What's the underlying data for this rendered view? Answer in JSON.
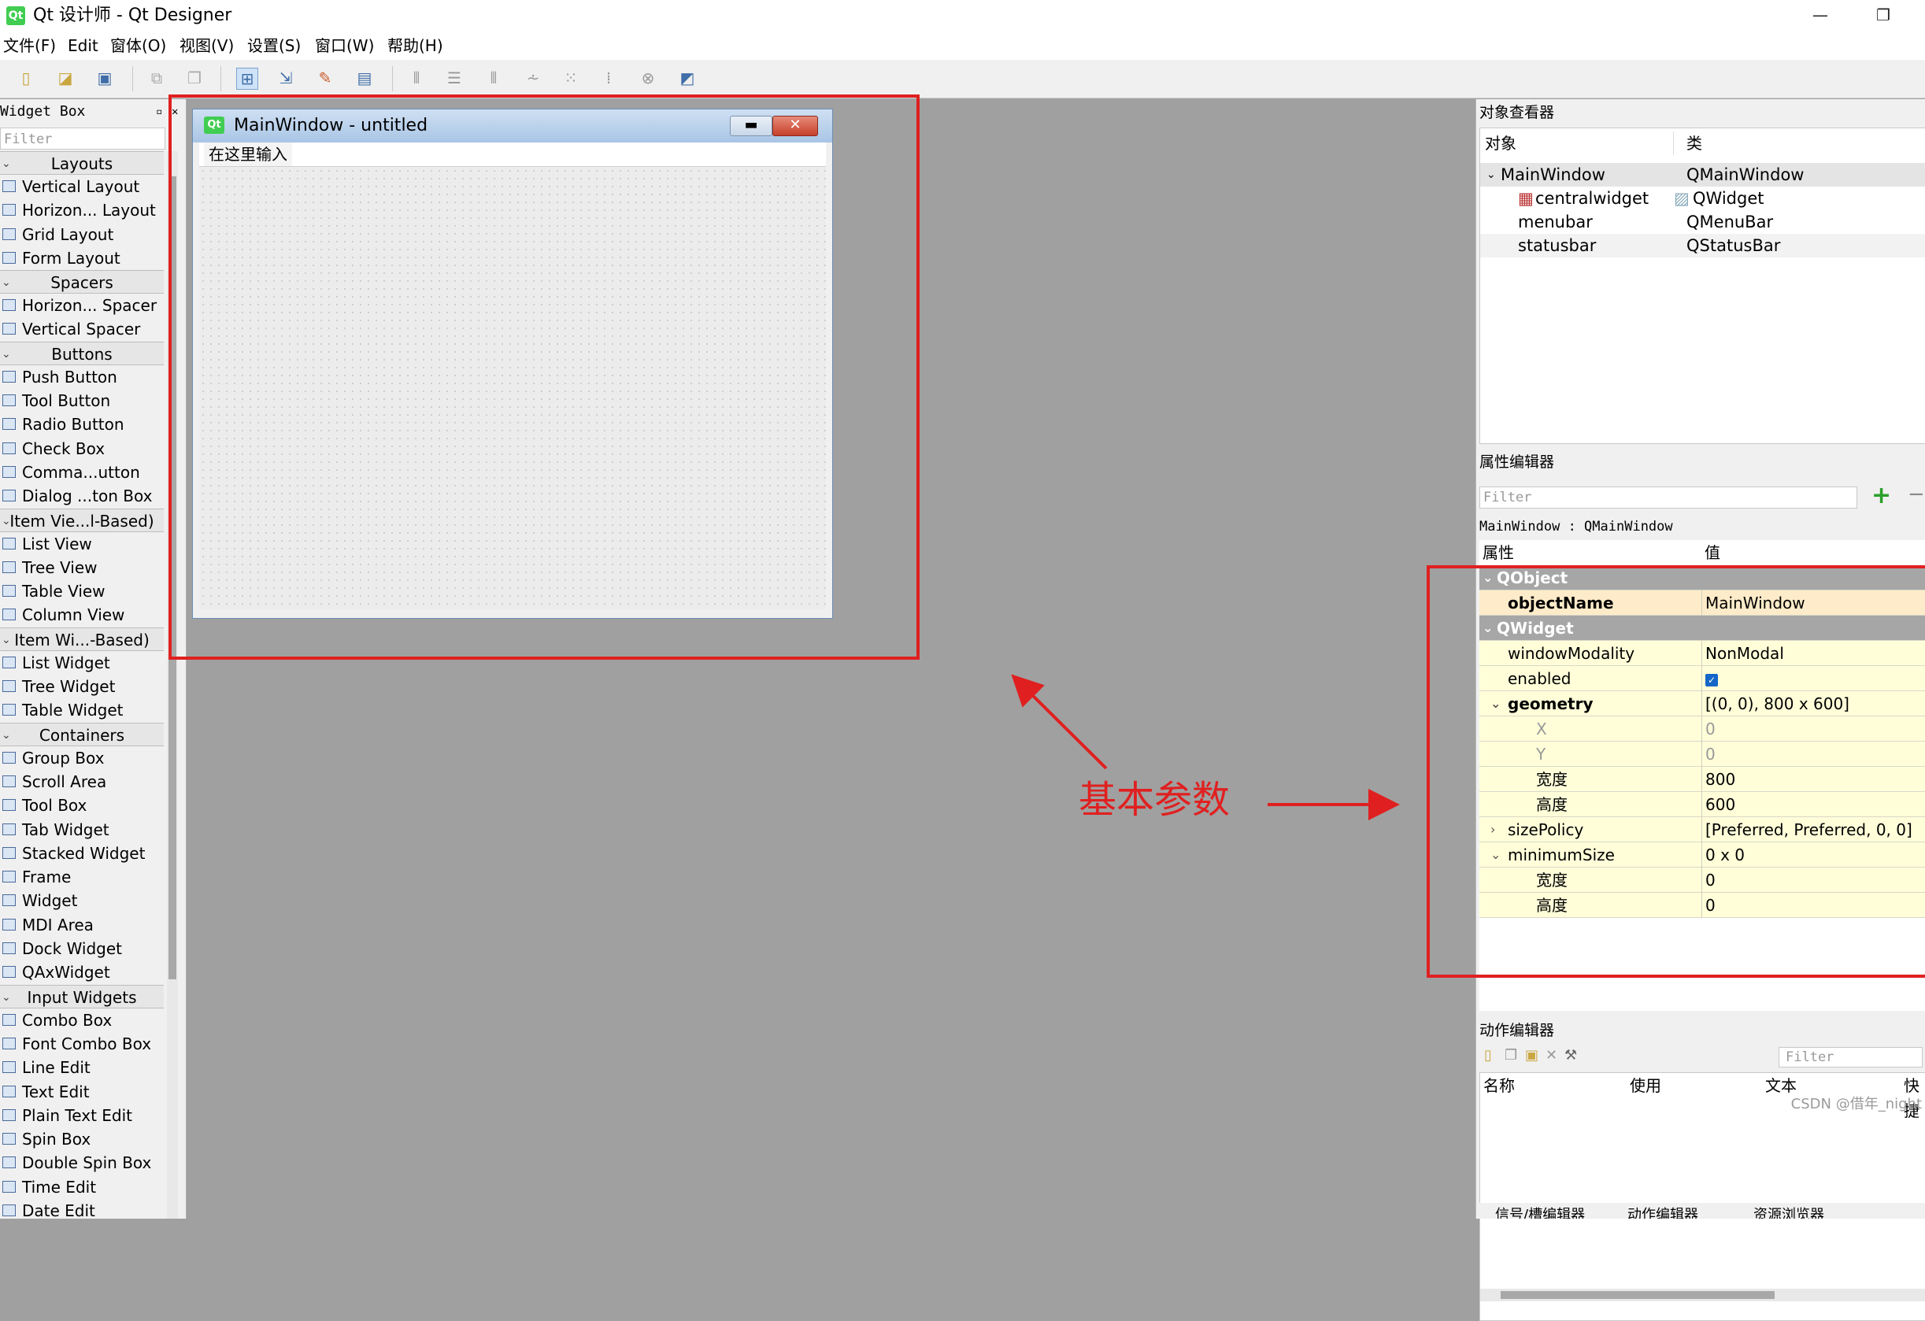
{
  "window": {
    "title": "Qt 设计师 - Qt Designer",
    "logo": "Qt",
    "minimize": "—",
    "restore": "❐"
  },
  "menubar": [
    "文件(F)",
    "Edit",
    "窗体(O)",
    "视图(V)",
    "设置(S)",
    "窗口(W)",
    "帮助(H)"
  ],
  "toolbar_icons": [
    "new-file-icon",
    "open-folder-icon",
    "save-icon",
    "cut-icon",
    "copy-icon",
    "edit-widgets-icon",
    "edit-signals-icon",
    "edit-buddies-icon",
    "edit-tab-order-icon",
    "layout-horizontal-icon",
    "layout-vertical-icon",
    "layout-h-splitter-icon",
    "layout-v-splitter-icon",
    "layout-grid-icon",
    "layout-form-icon",
    "break-layout-icon",
    "adjust-size-icon"
  ],
  "widget_box": {
    "title": "Widget Box",
    "filter_placeholder": "Filter",
    "groups": [
      {
        "name": "Layouts",
        "items": [
          "Vertical Layout",
          "Horizon... Layout",
          "Grid Layout",
          "Form Layout"
        ]
      },
      {
        "name": "Spacers",
        "items": [
          "Horizon... Spacer",
          "Vertical Spacer"
        ]
      },
      {
        "name": "Buttons",
        "items": [
          "Push Button",
          "Tool Button",
          "Radio Button",
          "Check Box",
          "Comma...utton",
          "Dialog ...ton Box"
        ]
      },
      {
        "name": "Item Vie...l-Based)",
        "items": [
          "List View",
          "Tree View",
          "Table View",
          "Column View"
        ]
      },
      {
        "name": "Item Wi...-Based)",
        "items": [
          "List Widget",
          "Tree Widget",
          "Table Widget"
        ]
      },
      {
        "name": "Containers",
        "items": [
          "Group Box",
          "Scroll Area",
          "Tool Box",
          "Tab Widget",
          "Stacked Widget",
          "Frame",
          "Widget",
          "MDI Area",
          "Dock Widget",
          "QAxWidget"
        ]
      },
      {
        "name": "Input Widgets",
        "items": [
          "Combo Box",
          "Font Combo Box",
          "Line Edit",
          "Text Edit",
          "Plain Text Edit",
          "Spin Box",
          "Double Spin Box",
          "Time Edit",
          "Date Edit"
        ]
      }
    ]
  },
  "form": {
    "logo": "Qt",
    "title": "MainWindow - untitled",
    "menu_placeholder": "在这里输入",
    "min_glyph": "▬",
    "close_glyph": "✕"
  },
  "annotation": {
    "label": "基本参数",
    "color": "#e02020"
  },
  "object_inspector": {
    "title": "对象查看器",
    "col_object": "对象",
    "col_class": "类",
    "rows": [
      {
        "object": "MainWindow",
        "class": "QMainWindow"
      },
      {
        "object": "centralwidget",
        "class": "QWidget"
      },
      {
        "object": "menubar",
        "class": "QMenuBar"
      },
      {
        "object": "statusbar",
        "class": "QStatusBar"
      }
    ]
  },
  "property_editor": {
    "title": "属性编辑器",
    "filter_placeholder": "Filter",
    "object_line": "MainWindow : QMainWindow",
    "col_property": "属性",
    "col_value": "值",
    "sections": {
      "qobject": "QObject",
      "qwidget": "QWidget"
    },
    "rows": {
      "objectName": {
        "k": "objectName",
        "v": "MainWindow"
      },
      "windowModality": {
        "k": "windowModality",
        "v": "NonModal"
      },
      "enabled": {
        "k": "enabled",
        "v": ""
      },
      "geometry": {
        "k": "geometry",
        "v": "[(0, 0), 800 x 600]"
      },
      "x": {
        "k": "X",
        "v": "0"
      },
      "y": {
        "k": "Y",
        "v": "0"
      },
      "width": {
        "k": "宽度",
        "v": "800"
      },
      "height": {
        "k": "高度",
        "v": "600"
      },
      "sizePolicy": {
        "k": "sizePolicy",
        "v": "[Preferred, Preferred, 0, 0]"
      },
      "minimumSize": {
        "k": "minimumSize",
        "v": "0 x 0"
      },
      "min_width": {
        "k": "宽度",
        "v": "0"
      },
      "min_height": {
        "k": "高度",
        "v": "0"
      }
    }
  },
  "action_editor": {
    "title": "动作编辑器",
    "filter_placeholder": "Filter",
    "columns": [
      "名称",
      "使用",
      "文本",
      "快捷"
    ]
  },
  "bottom_tabs": [
    "信号/槽编辑器",
    "动作编辑器",
    "资源浏览器"
  ],
  "watermark": "CSDN @借年_night"
}
